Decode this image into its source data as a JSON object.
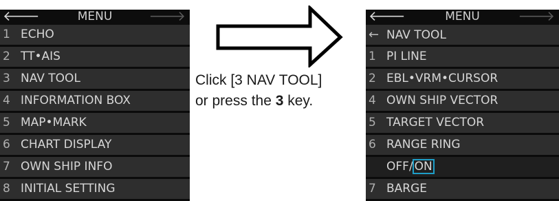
{
  "left_menu": {
    "title": "MENU",
    "back_icon": "left-arrow-icon",
    "forward_icon": "right-arrow-icon",
    "items": [
      {
        "num": "1",
        "label": "ECHO"
      },
      {
        "num": "2",
        "label": "TT•AIS"
      },
      {
        "num": "3",
        "label": "NAV TOOL"
      },
      {
        "num": "4",
        "label": "INFORMATION BOX"
      },
      {
        "num": "5",
        "label": "MAP•MARK"
      },
      {
        "num": "6",
        "label": "CHART DISPLAY"
      },
      {
        "num": "7",
        "label": "OWN SHIP INFO"
      },
      {
        "num": "8",
        "label": "INITIAL SETTING"
      }
    ]
  },
  "instruction": {
    "line1": "Click [3 NAV TOOL]",
    "line2_prefix": "or press the ",
    "line2_key": "3",
    "line2_suffix": " key."
  },
  "right_menu": {
    "title": "MENU",
    "back_icon": "left-arrow-icon",
    "forward_icon": "right-arrow-icon",
    "back_row": {
      "num": "←",
      "label": "NAV TOOL"
    },
    "items": [
      {
        "num": "1",
        "label": "PI LINE"
      },
      {
        "num": "2",
        "label": "EBL•VRM•CURSOR"
      },
      {
        "num": "4",
        "label": "OWN SHIP VECTOR"
      },
      {
        "num": "5",
        "label": "TARGET VECTOR"
      },
      {
        "num": "6",
        "label": "RANGE RING"
      }
    ],
    "range_ring_option": {
      "off": "OFF",
      "sep": "/",
      "on": "ON"
    },
    "last_item": {
      "num": "7",
      "label": "BARGE"
    }
  },
  "colors": {
    "highlight": "#1e9ec8",
    "panel_bg": "#0d0d0d",
    "row_bg": "#2e2e2e"
  }
}
